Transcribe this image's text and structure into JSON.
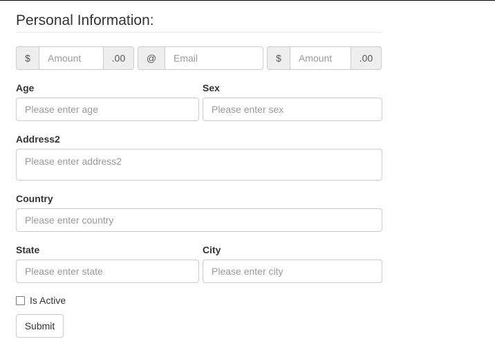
{
  "form": {
    "legend": "Personal Information:",
    "groups": [
      {
        "prefix": "$",
        "placeholder": "Amount",
        "suffix": ".00"
      },
      {
        "prefix": "@",
        "placeholder": "Email"
      },
      {
        "prefix": "$",
        "placeholder": "Amount",
        "suffix": ".00"
      }
    ],
    "age": {
      "label": "Age",
      "placeholder": "Please enter age"
    },
    "sex": {
      "label": "Sex",
      "placeholder": "Please enter sex"
    },
    "address2": {
      "label": "Address2",
      "placeholder": "Please enter address2"
    },
    "country": {
      "label": "Country",
      "placeholder": "Please enter country"
    },
    "state": {
      "label": "State",
      "placeholder": "Please enter state"
    },
    "city": {
      "label": "City",
      "placeholder": "Please enter city"
    },
    "is_active": {
      "label": "Is Active",
      "checked": false
    },
    "submit_label": "Submit"
  }
}
